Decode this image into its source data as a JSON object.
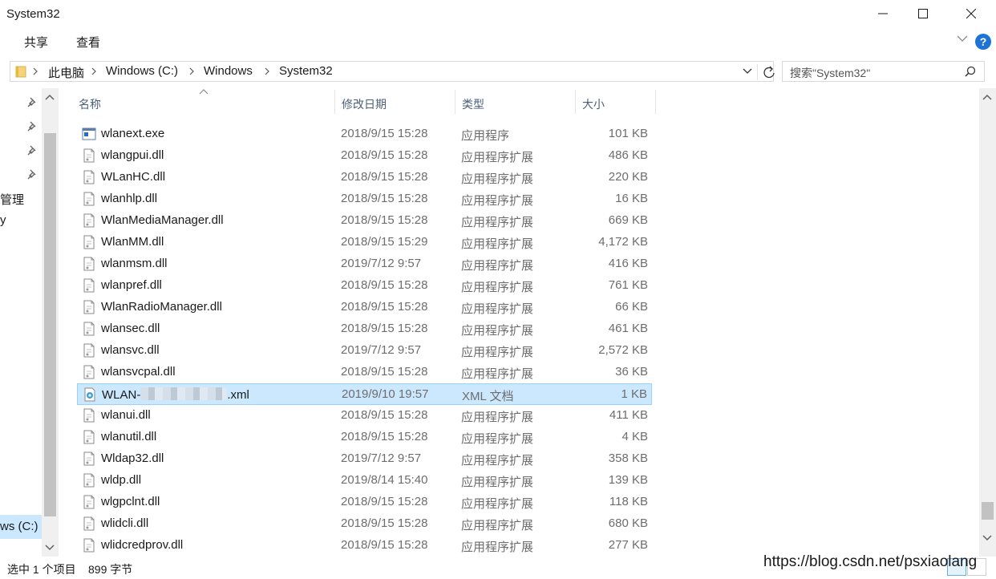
{
  "window": {
    "title": "System32",
    "minimize_icon": "minimize-icon",
    "maximize_icon": "maximize-icon",
    "close_icon": "close-icon"
  },
  "ribbon": {
    "tabs": [
      "共享",
      "查看"
    ],
    "help_label": "?"
  },
  "address": {
    "crumbs": [
      "此电脑",
      "Windows (C:)",
      "Windows",
      "System32"
    ],
    "search_placeholder": "搜索\"System32\""
  },
  "nav": {
    "items": [
      "管理",
      "y",
      "ws (C:)"
    ]
  },
  "columns": {
    "name": "名称",
    "date": "修改日期",
    "type": "类型",
    "size": "大小"
  },
  "files": [
    {
      "name": "wlanext.exe",
      "date": "2018/9/15 15:28",
      "type": "应用程序",
      "size": "101 KB",
      "icon": "exe-icon"
    },
    {
      "name": "wlangpui.dll",
      "date": "2018/9/15 15:28",
      "type": "应用程序扩展",
      "size": "486 KB",
      "icon": "dll-icon"
    },
    {
      "name": "WLanHC.dll",
      "date": "2018/9/15 15:28",
      "type": "应用程序扩展",
      "size": "220 KB",
      "icon": "dll-icon"
    },
    {
      "name": "wlanhlp.dll",
      "date": "2018/9/15 15:28",
      "type": "应用程序扩展",
      "size": "16 KB",
      "icon": "dll-icon"
    },
    {
      "name": "WlanMediaManager.dll",
      "date": "2018/9/15 15:28",
      "type": "应用程序扩展",
      "size": "669 KB",
      "icon": "dll-icon"
    },
    {
      "name": "WlanMM.dll",
      "date": "2018/9/15 15:29",
      "type": "应用程序扩展",
      "size": "4,172 KB",
      "icon": "dll-icon"
    },
    {
      "name": "wlanmsm.dll",
      "date": "2019/7/12 9:57",
      "type": "应用程序扩展",
      "size": "416 KB",
      "icon": "dll-icon"
    },
    {
      "name": "wlanpref.dll",
      "date": "2018/9/15 15:28",
      "type": "应用程序扩展",
      "size": "761 KB",
      "icon": "dll-icon"
    },
    {
      "name": "WlanRadioManager.dll",
      "date": "2018/9/15 15:28",
      "type": "应用程序扩展",
      "size": "66 KB",
      "icon": "dll-icon"
    },
    {
      "name": "wlansec.dll",
      "date": "2018/9/15 15:28",
      "type": "应用程序扩展",
      "size": "461 KB",
      "icon": "dll-icon"
    },
    {
      "name": "wlansvc.dll",
      "date": "2019/7/12 9:57",
      "type": "应用程序扩展",
      "size": "2,572 KB",
      "icon": "dll-icon"
    },
    {
      "name": "wlansvcpal.dll",
      "date": "2018/9/15 15:28",
      "type": "应用程序扩展",
      "size": "36 KB",
      "icon": "dll-icon"
    },
    {
      "name_prefix": "WLAN-",
      "name_suffix": ".xml",
      "date": "2019/9/10 19:57",
      "type": "XML 文档",
      "size": "1 KB",
      "icon": "xml-icon",
      "selected": true
    },
    {
      "name": "wlanui.dll",
      "date": "2018/9/15 15:28",
      "type": "应用程序扩展",
      "size": "411 KB",
      "icon": "dll-icon"
    },
    {
      "name": "wlanutil.dll",
      "date": "2018/9/15 15:28",
      "type": "应用程序扩展",
      "size": "4 KB",
      "icon": "dll-icon"
    },
    {
      "name": "Wldap32.dll",
      "date": "2019/7/12 9:57",
      "type": "应用程序扩展",
      "size": "358 KB",
      "icon": "dll-icon"
    },
    {
      "name": "wldp.dll",
      "date": "2019/8/14 15:40",
      "type": "应用程序扩展",
      "size": "139 KB",
      "icon": "dll-icon"
    },
    {
      "name": "wlgpclnt.dll",
      "date": "2018/9/15 15:28",
      "type": "应用程序扩展",
      "size": "118 KB",
      "icon": "dll-icon"
    },
    {
      "name": "wlidcli.dll",
      "date": "2018/9/15 15:28",
      "type": "应用程序扩展",
      "size": "680 KB",
      "icon": "dll-icon"
    },
    {
      "name": "wlidcredprov.dll",
      "date": "2018/9/15 15:28",
      "type": "应用程序扩展",
      "size": "277 KB",
      "icon": "dll-icon"
    }
  ],
  "status": {
    "selected": "选中 1 个项目",
    "size": "899 字节"
  },
  "watermark": "https://blog.csdn.net/psxiaolang",
  "colors": {
    "selection": "#cce8ff",
    "selection_border": "#99d1ff",
    "accent": "#1e74d6"
  }
}
